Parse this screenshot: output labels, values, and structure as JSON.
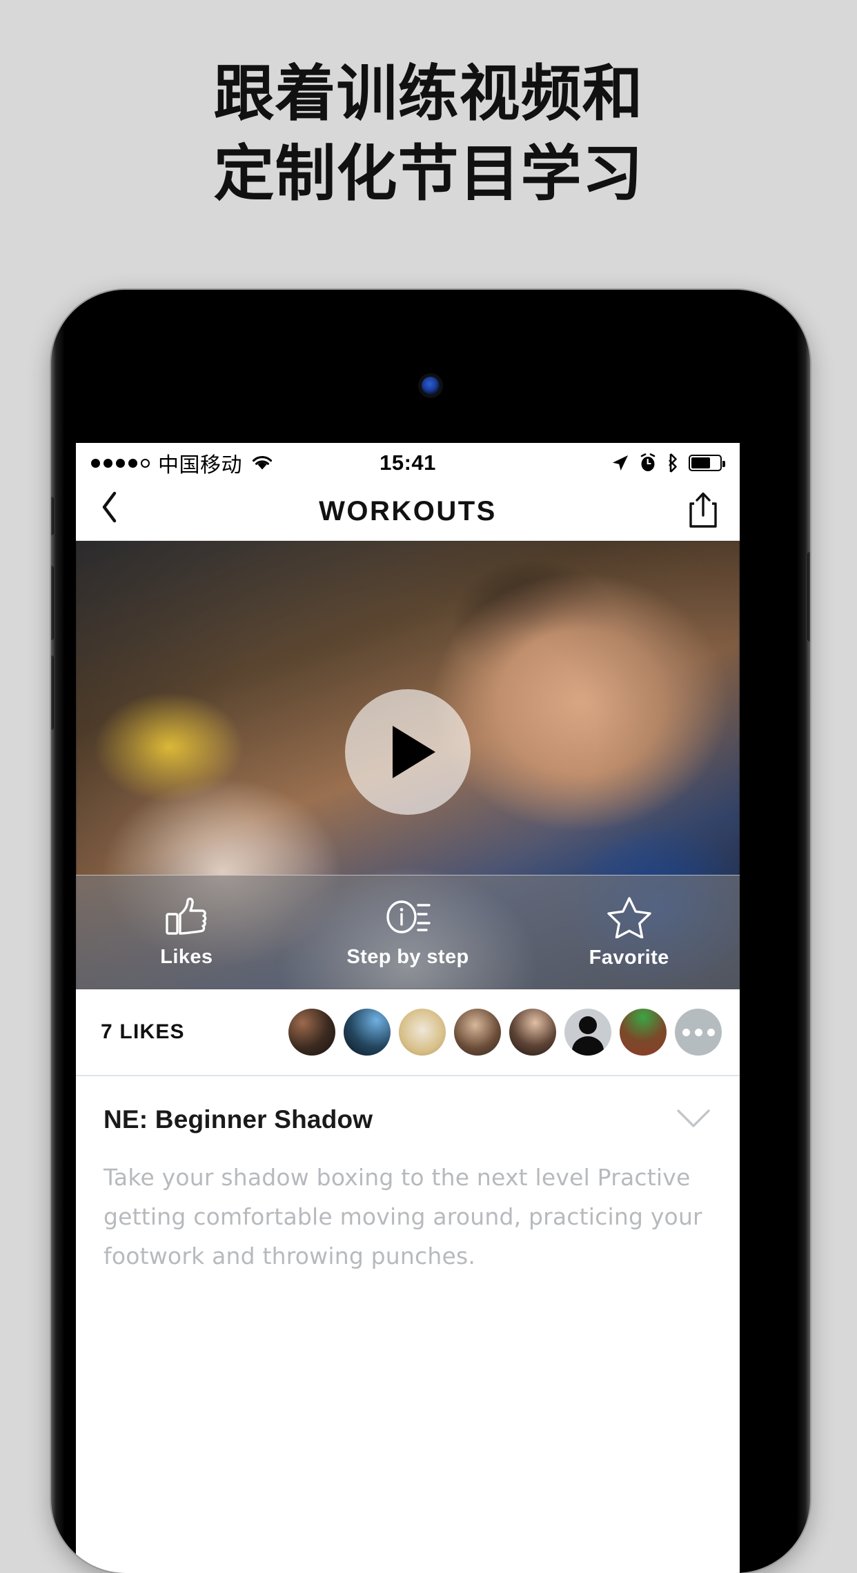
{
  "headline": {
    "line1": "跟着训练视频和",
    "line2": "定制化节目学习"
  },
  "statusbar": {
    "signal_dots_filled": 4,
    "signal_dots_hollow": 1,
    "carrier": "中国移动",
    "wifi_icon": "wifi-icon",
    "time": "15:41",
    "location_icon": "location-arrow-icon",
    "alarm_icon": "alarm-clock-icon",
    "bluetooth_icon": "bluetooth-icon",
    "battery_icon": "battery-icon"
  },
  "navbar": {
    "back_icon": "chevron-left-icon",
    "title": "WORKOUTS",
    "share_icon": "share-icon"
  },
  "hero": {
    "play_icon": "play-icon"
  },
  "actionbar": {
    "items": [
      {
        "icon": "thumbs-up-icon",
        "label": "Likes"
      },
      {
        "icon": "info-list-icon",
        "label": "Step by step"
      },
      {
        "icon": "star-icon",
        "label": "Favorite"
      }
    ]
  },
  "likes": {
    "count": "7",
    "label": "LIKES",
    "count_text": "7  LIKES",
    "avatars": [
      {
        "name": "avatar-1",
        "type": "photo",
        "colors": [
          "#7a4f3a",
          "#3b2a20",
          "#c59a6d"
        ]
      },
      {
        "name": "avatar-2",
        "type": "photo",
        "colors": [
          "#5b9bd5",
          "#1b2b3a",
          "#0d1620"
        ]
      },
      {
        "name": "avatar-3",
        "type": "photo",
        "colors": [
          "#efe7d8",
          "#d8c08a",
          "#b79a5c"
        ]
      },
      {
        "name": "avatar-4",
        "type": "photo",
        "colors": [
          "#8e6a52",
          "#2d2723",
          "#d7b89a"
        ]
      },
      {
        "name": "avatar-5",
        "type": "photo",
        "colors": [
          "#d9b79c",
          "#231c18",
          "#6b4c3a"
        ]
      },
      {
        "name": "avatar-6",
        "type": "silhouette",
        "colors": [
          "#c9cdd1",
          "#0d0d0d",
          "#0d0d0d"
        ]
      },
      {
        "name": "avatar-7",
        "type": "photo",
        "colors": [
          "#2e7d32",
          "#7a4a2a",
          "#c0392b"
        ]
      }
    ],
    "more_icon": "more-dots-icon"
  },
  "detail": {
    "title": "NE: Beginner Shadow",
    "collapse_icon": "chevron-down-icon",
    "description": "Take your shadow boxing to the next level Practive getting comfortable moving around, practicing your footwork and throwing punches."
  },
  "colors": {
    "page_background": "#d8d8d8",
    "headline_text": "#111111",
    "screen_background": "#ffffff",
    "description_text": "#b7babd",
    "actionbar_overlay": "rgba(120,120,122,0.62)",
    "divider": "#dfe5ea"
  }
}
